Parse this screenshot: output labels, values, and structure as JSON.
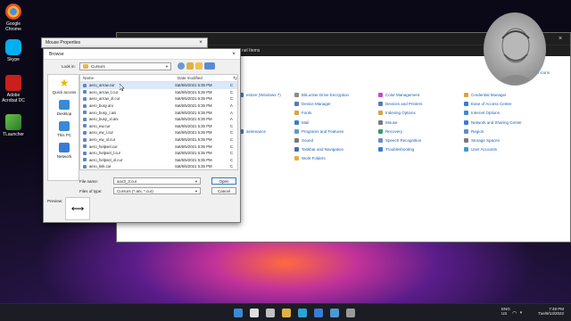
{
  "desktop": {
    "icons": [
      {
        "label": "Google Chrome",
        "icon": "chrome-icon",
        "color": "#e8453c"
      },
      {
        "label": "Skype",
        "icon": "skype-icon",
        "color": "#00aff0"
      },
      {
        "label": "Adobe Acrobat DC",
        "icon": "acrobat-icon",
        "color": "#d4271f"
      },
      {
        "label": "TLauncher",
        "icon": "tlauncher-icon",
        "color": "#3a9a3a"
      }
    ]
  },
  "control_panel": {
    "address": "nel Items",
    "view_by_label": "View by:",
    "view_by_value": "Small icons",
    "columns": [
      [
        {
          "label": "estore (Windows 7)",
          "color": "#3a7bd5"
        },
        {
          "label": "",
          "color": "#ffffff"
        },
        {
          "label": "",
          "color": "#ffffff"
        },
        {
          "label": "",
          "color": "#ffffff"
        },
        {
          "label": "aintenance",
          "color": "#3a7bd5"
        }
      ],
      [
        {
          "label": "BitLocker Drive Encryption",
          "color": "#8a8a8a"
        },
        {
          "label": "Device Manager",
          "color": "#5a7ab5"
        },
        {
          "label": "Fonts",
          "color": "#d9a43a"
        },
        {
          "label": "Mail",
          "color": "#3a7bd5"
        },
        {
          "label": "Programs and Features",
          "color": "#5a9ad5"
        },
        {
          "label": "Sound",
          "color": "#7a7a7a"
        },
        {
          "label": "Taskbar and Navigation",
          "color": "#4a6ab5"
        },
        {
          "label": "Work Folders",
          "color": "#e0b040"
        }
      ],
      [
        {
          "label": "Color Management",
          "color": "#c64ac6"
        },
        {
          "label": "Devices and Printers",
          "color": "#5a7ab5"
        },
        {
          "label": "Indexing Options",
          "color": "#d9a43a"
        },
        {
          "label": "Mouse",
          "color": "#7a7a7a"
        },
        {
          "label": "Recovery",
          "color": "#3a9a6a"
        },
        {
          "label": "Speech Recognition",
          "color": "#6a8ac5"
        },
        {
          "label": "Troubleshooting",
          "color": "#3a7bd5"
        }
      ],
      [
        {
          "label": "Credential Manager",
          "color": "#d9a43a"
        },
        {
          "label": "Ease of Access Center",
          "color": "#3a7bd5"
        },
        {
          "label": "Internet Options",
          "color": "#3a8ad5"
        },
        {
          "label": "Network and Sharing Center",
          "color": "#3a7bd5"
        },
        {
          "label": "Region",
          "color": "#5a8ad5"
        },
        {
          "label": "Storage Spaces",
          "color": "#7a7a7a"
        },
        {
          "label": "User Accounts",
          "color": "#3a9ad5"
        }
      ]
    ]
  },
  "mouse_properties": {
    "title": "Mouse Properties"
  },
  "browse": {
    "title": "Browse",
    "look_in_label": "Look in:",
    "look_in_value": "Cursors",
    "places": [
      {
        "label": "Quick access",
        "icon": "star-icon",
        "color": "#f0b400"
      },
      {
        "label": "Desktop",
        "icon": "desktop-icon",
        "color": "#3a8ad5"
      },
      {
        "label": "This PC",
        "icon": "computer-icon",
        "color": "#3a8ad5"
      },
      {
        "label": "Network",
        "icon": "network-icon",
        "color": "#3a7bd5"
      }
    ],
    "headers": {
      "name": "Name",
      "date": "Date modified",
      "type": "Ty"
    },
    "files": [
      {
        "name": "aero_arrow.cur",
        "date": "Sat/6/5/2021 5:35 PM",
        "type": "C"
      },
      {
        "name": "aero_arrow_l.cur",
        "date": "Sat/6/5/2021 5:35 PM",
        "type": "C"
      },
      {
        "name": "aero_arrow_xl.cur",
        "date": "Sat/6/5/2021 5:35 PM",
        "type": "C"
      },
      {
        "name": "aero_busy.ani",
        "date": "Sat/6/5/2021 5:35 PM",
        "type": "A"
      },
      {
        "name": "aero_busy_l.ani",
        "date": "Sat/6/5/2021 5:35 PM",
        "type": "A"
      },
      {
        "name": "aero_busy_xl.ani",
        "date": "Sat/6/5/2021 5:35 PM",
        "type": "A"
      },
      {
        "name": "aero_ew.cur",
        "date": "Sat/6/5/2021 5:35 PM",
        "type": "C"
      },
      {
        "name": "aero_ew_l.cur",
        "date": "Sat/6/5/2021 5:35 PM",
        "type": "C"
      },
      {
        "name": "aero_ew_xl.cur",
        "date": "Sat/6/5/2021 5:35 PM",
        "type": "C"
      },
      {
        "name": "aero_helpsel.cur",
        "date": "Sat/6/5/2021 5:35 PM",
        "type": "C"
      },
      {
        "name": "aero_helpsel_l.cur",
        "date": "Sat/6/5/2021 5:35 PM",
        "type": "C"
      },
      {
        "name": "aero_helpsel_xl.cur",
        "date": "Sat/6/5/2021 5:35 PM",
        "type": "C"
      },
      {
        "name": "aero_link.cur",
        "date": "Sat/6/5/2021 5:35 PM",
        "type": "C"
      }
    ],
    "file_name_label": "File name:",
    "file_name_value": "aox3_3.cur",
    "files_of_type_label": "Files of type:",
    "files_of_type_value": "Cursors (*.ani, *.cur)",
    "open_label": "Open",
    "cancel_label": "Cancel",
    "preview_label": "Preview:",
    "preview_glyph": "⟷"
  },
  "taskbar": {
    "icons": [
      {
        "icon": "start-icon",
        "color": "#3a8ad5"
      },
      {
        "icon": "search-icon",
        "color": "#e0e0e0"
      },
      {
        "icon": "task-view-icon",
        "color": "#c0c0c0"
      },
      {
        "icon": "file-explorer-icon",
        "color": "#e0b040"
      },
      {
        "icon": "edge-icon",
        "color": "#2aa3d6"
      },
      {
        "icon": "store-icon",
        "color": "#3a7bd5"
      },
      {
        "icon": "photos-icon",
        "color": "#4a9ad5"
      },
      {
        "icon": "mouse-settings-icon",
        "color": "#9a9a9a"
      }
    ],
    "lang_top": "ENG",
    "lang_bottom": "US",
    "time": "7:49 PM",
    "date": "Tue/9/13/2022"
  }
}
